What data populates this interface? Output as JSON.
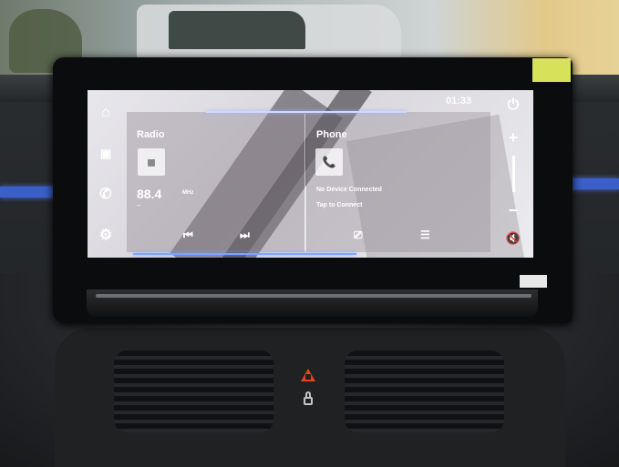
{
  "screen": {
    "clock": "01:33",
    "radio": {
      "title": "Radio",
      "frequency": "88.4",
      "unit": "MHz",
      "subtext": "–",
      "tile_icon": "radio-tile-icon",
      "prev_label": "⏮",
      "next_label": "⏭"
    },
    "phone": {
      "title": "Phone",
      "tile_icon": "phone-icon",
      "status": "No Device Connected",
      "action": "Tap to Connect",
      "tile_glyph": "📞",
      "mirror_label": "⎚",
      "list_label": "☰"
    },
    "left_rail": {
      "home": "⌂",
      "media": "▣",
      "phone": "✆",
      "settings": "⚙"
    },
    "right_rail": {
      "power": "⏻",
      "vol_up": "+",
      "vol_down": "−",
      "mute": "🔇"
    }
  },
  "colors": {
    "ambient_light": "#3a5fc8",
    "hazard": "#e4431c",
    "tag": "#d8e15a"
  }
}
